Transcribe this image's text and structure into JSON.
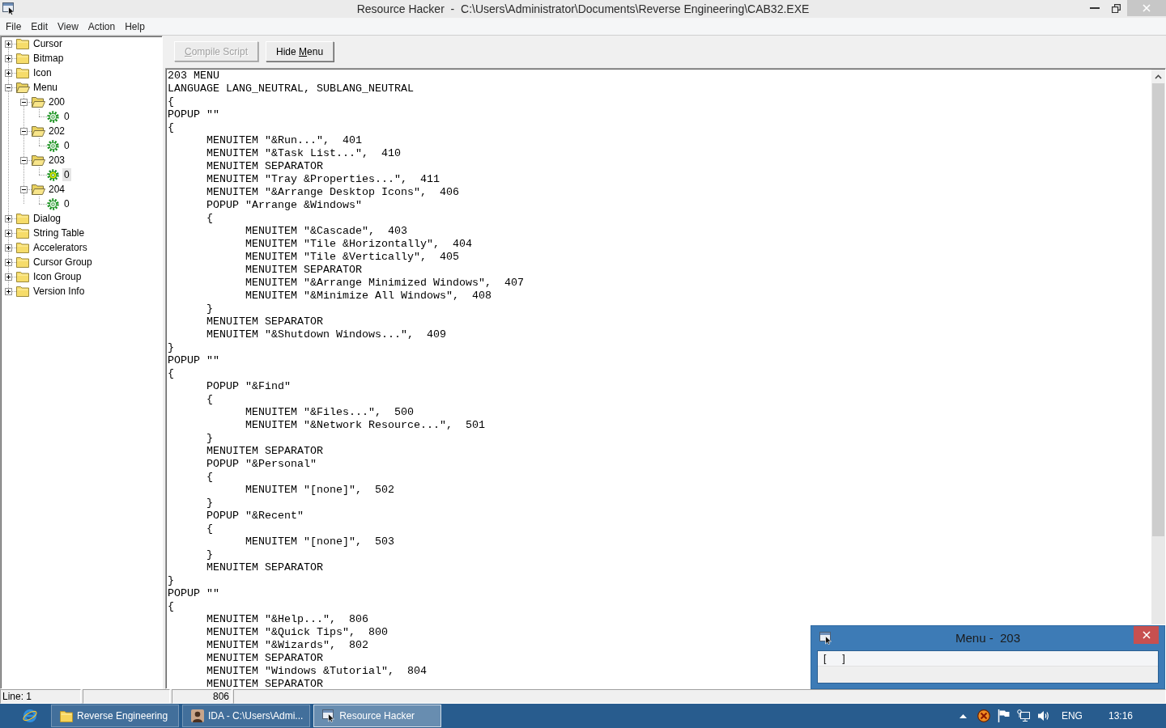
{
  "window": {
    "title": "Resource Hacker  -  C:\\Users\\Administrator\\Documents\\Reverse Engineering\\CAB32.EXE"
  },
  "menu_bar": [
    "File",
    "Edit",
    "View",
    "Action",
    "Help"
  ],
  "tree": {
    "items": [
      {
        "label": "Cursor",
        "kind": "folder",
        "expanded": false,
        "selected": false
      },
      {
        "label": "Bitmap",
        "kind": "folder",
        "expanded": false,
        "selected": false
      },
      {
        "label": "Icon",
        "kind": "folder",
        "expanded": false,
        "selected": false
      },
      {
        "label": "Menu",
        "kind": "folder",
        "expanded": true,
        "selected": false,
        "children": [
          {
            "label": "200",
            "kind": "folder",
            "expanded": true,
            "selected": false,
            "children": [
              {
                "label": "0",
                "kind": "resource",
                "selected": false
              }
            ]
          },
          {
            "label": "202",
            "kind": "folder",
            "expanded": true,
            "selected": false,
            "children": [
              {
                "label": "0",
                "kind": "resource",
                "selected": false
              }
            ]
          },
          {
            "label": "203",
            "kind": "folder",
            "expanded": true,
            "selected": false,
            "children": [
              {
                "label": "0",
                "kind": "resource",
                "selected": true
              }
            ]
          },
          {
            "label": "204",
            "kind": "folder",
            "expanded": true,
            "selected": false,
            "children": [
              {
                "label": "0",
                "kind": "resource",
                "selected": false
              }
            ]
          }
        ]
      },
      {
        "label": "Dialog",
        "kind": "folder",
        "expanded": false,
        "selected": false
      },
      {
        "label": "String Table",
        "kind": "folder",
        "expanded": false,
        "selected": false
      },
      {
        "label": "Accelerators",
        "kind": "folder",
        "expanded": false,
        "selected": false
      },
      {
        "label": "Cursor Group",
        "kind": "folder",
        "expanded": false,
        "selected": false
      },
      {
        "label": "Icon Group",
        "kind": "folder",
        "expanded": false,
        "selected": false
      },
      {
        "label": "Version Info",
        "kind": "folder",
        "expanded": false,
        "selected": false
      }
    ]
  },
  "toolbar": {
    "buttons": [
      {
        "label_parts": [
          {
            "text": "C",
            "underlined": true
          },
          {
            "text": "ompile Script",
            "underlined": false
          }
        ],
        "disabled": true
      },
      {
        "label_parts": [
          {
            "text": "Hide ",
            "underlined": false
          },
          {
            "text": "M",
            "underlined": true
          },
          {
            "text": "enu",
            "underlined": false
          }
        ],
        "disabled": false
      }
    ]
  },
  "editor": {
    "lines": [
      {
        "text": "203 MENU"
      },
      {
        "text": "LANGUAGE LANG_NEUTRAL, SUBLANG_NEUTRAL"
      },
      {
        "text": "{"
      },
      {
        "text": "POPUP \"\""
      },
      {
        "text": "{",
        "children": [
          {
            "text": "MENUITEM \"&Run...\",  401"
          },
          {
            "text": "MENUITEM \"&Task List...\",  410"
          },
          {
            "text": "MENUITEM SEPARATOR"
          },
          {
            "text": "MENUITEM \"Tray &Properties...\",  411"
          },
          {
            "text": "MENUITEM \"&Arrange Desktop Icons\",  406"
          },
          {
            "text": "POPUP \"Arrange &Windows\""
          },
          {
            "text": "{",
            "children": [
              {
                "text": "MENUITEM \"&Cascade\",  403"
              },
              {
                "text": "MENUITEM \"Tile &Horizontally\",  404"
              },
              {
                "text": "MENUITEM \"Tile &Vertically\",  405"
              },
              {
                "text": "MENUITEM SEPARATOR"
              },
              {
                "text": "MENUITEM \"&Arrange Minimized Windows\",  407"
              },
              {
                "text": "MENUITEM \"&Minimize All Windows\",  408"
              }
            ]
          },
          {
            "text": "}"
          },
          {
            "text": "MENUITEM SEPARATOR"
          },
          {
            "text": "MENUITEM \"&Shutdown Windows...\",  409"
          }
        ]
      },
      {
        "text": "}"
      },
      {
        "text": "POPUP \"\""
      },
      {
        "text": "{",
        "children": [
          {
            "text": "POPUP \"&Find\""
          },
          {
            "text": "{",
            "children": [
              {
                "text": "MENUITEM \"&Files...\",  500"
              },
              {
                "text": "MENUITEM \"&Network Resource...\",  501"
              }
            ]
          },
          {
            "text": "}"
          },
          {
            "text": "MENUITEM SEPARATOR"
          },
          {
            "text": "POPUP \"&Personal\""
          },
          {
            "text": "{",
            "children": [
              {
                "text": "MENUITEM \"[none]\",  502"
              }
            ]
          },
          {
            "text": "}"
          },
          {
            "text": "POPUP \"&Recent\""
          },
          {
            "text": "{",
            "children": [
              {
                "text": "MENUITEM \"[none]\",  503"
              }
            ]
          },
          {
            "text": "}"
          },
          {
            "text": "MENUITEM SEPARATOR"
          }
        ]
      },
      {
        "text": "}"
      },
      {
        "text": "POPUP \"\""
      },
      {
        "text": "{",
        "children": [
          {
            "text": "MENUITEM \"&Help...\",  806"
          },
          {
            "text": "MENUITEM \"&Quick Tips\",  800"
          },
          {
            "text": "MENUITEM \"&Wizards\",  802"
          },
          {
            "text": "MENUITEM SEPARATOR"
          },
          {
            "text": "MENUITEM \"Windows &Tutorial\",  804"
          },
          {
            "text": "MENUITEM SEPARATOR"
          }
        ]
      }
    ]
  },
  "status_bar": {
    "pane_1": "Line: 1",
    "pane_3": "806"
  },
  "preview_window": {
    "title": "Menu -  203",
    "menu_items": [
      "[      ]"
    ]
  },
  "taskbar": {
    "items": [
      {
        "label": "Reverse Engineering",
        "kind": "folder",
        "selected": false
      },
      {
        "label": "IDA - C:\\Users\\Admi...",
        "kind": "portrait",
        "selected": false
      },
      {
        "label": "Resource Hacker",
        "kind": "tool",
        "selected": true
      }
    ],
    "tray": {
      "language": "ENG",
      "time": "13:16"
    }
  }
}
